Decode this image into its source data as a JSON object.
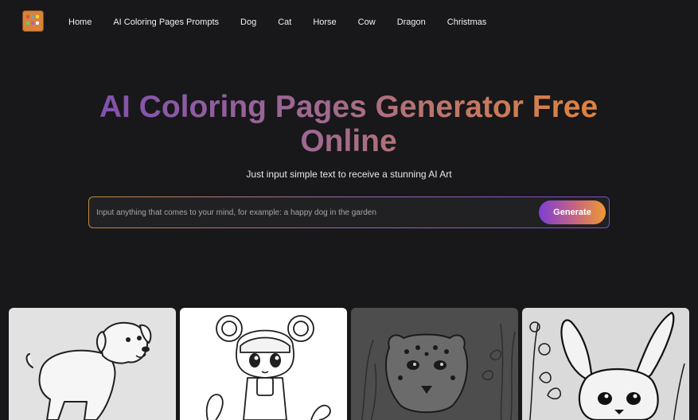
{
  "nav": {
    "logo_icon": "coloring-pages-logo",
    "links": [
      "Home",
      "AI Coloring Pages Prompts",
      "Dog",
      "Cat",
      "Horse",
      "Cow",
      "Dragon",
      "Christmas"
    ]
  },
  "hero": {
    "title": "AI Coloring Pages Generator Free Online",
    "subtitle": "Just input simple text to receive a stunning AI Art"
  },
  "search": {
    "placeholder": "Input anything that comes to your mind, for example: a happy dog in the garden",
    "value": "",
    "button_label": "Generate"
  },
  "gallery": {
    "items": [
      {
        "subject": "puppy",
        "background": "#e4e4e4"
      },
      {
        "subject": "girl-with-flowers",
        "background": "#ffffff"
      },
      {
        "subject": "leopard-cub",
        "background": "#4f4f4f"
      },
      {
        "subject": "rabbit",
        "background": "#dcdcdc"
      }
    ]
  },
  "colors": {
    "page_background": "#18171a",
    "title_gradient_start": "#7d4fb0",
    "title_gradient_end": "#e68536",
    "button_gradient_start": "#7d3fd3",
    "button_gradient_end": "#ee9a33"
  }
}
